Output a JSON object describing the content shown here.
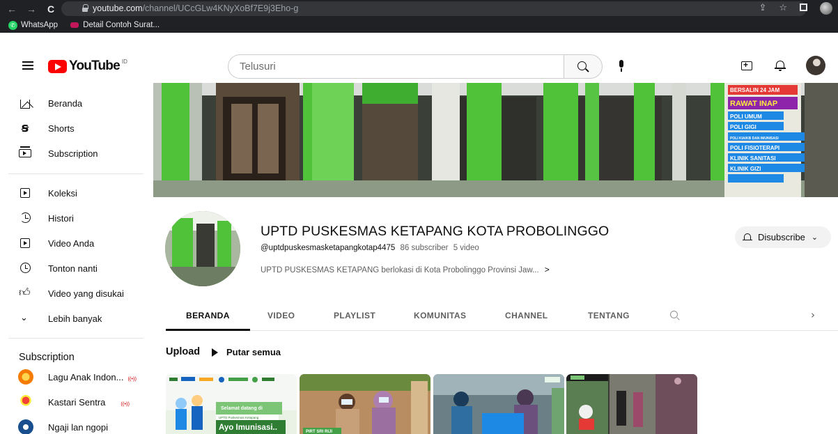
{
  "browser": {
    "url_host": "youtube.com",
    "url_path": "/channel/UCcGLw4KNyXoBf7E9j3Eho-g",
    "bookmarks": [
      {
        "label": "WhatsApp",
        "icon": "whatsapp-icon"
      },
      {
        "label": "Detail Contoh Surat...",
        "icon": "bookmark-favicon"
      }
    ]
  },
  "header": {
    "logo_text": "YouTube",
    "logo_region": "ID",
    "search_placeholder": "Telusuri"
  },
  "sidebar": {
    "items": [
      {
        "label": "Beranda",
        "icon": "home-icon"
      },
      {
        "label": "Shorts",
        "icon": "shorts-icon"
      },
      {
        "label": "Subscription",
        "icon": "subscriptions-icon"
      },
      {
        "label": "Koleksi",
        "icon": "library-icon"
      },
      {
        "label": "Histori",
        "icon": "history-icon"
      },
      {
        "label": "Video Anda",
        "icon": "your-videos-icon"
      },
      {
        "label": "Tonton nanti",
        "icon": "watch-later-icon"
      },
      {
        "label": "Video yang disukai",
        "icon": "liked-videos-icon"
      },
      {
        "label": "Lebih banyak",
        "icon": "chevron-down-icon"
      }
    ],
    "subscription_title": "Subscription",
    "subscriptions": [
      {
        "label": "Lagu Anak Indon...",
        "live": "((•))"
      },
      {
        "label": "Kastari Sentra",
        "live": "((•))"
      },
      {
        "label": "Ngaji lan ngopi",
        "live": ""
      }
    ]
  },
  "channel": {
    "name": "UPTD PUSKESMAS KETAPANG KOTA PROBOLINGGO",
    "handle": "@uptdpuskesmasketapangkotap4475",
    "subscribers": "86 subscriber",
    "videos": "5 video",
    "description": "UPTD PUSKESMAS KETAPANG berlokasi di Kota Probolinggo Provinsi Jaw...",
    "unsubscribe_label": "Disubscribe",
    "banner_signs": [
      "BERSALIN 24 JAM",
      "RAWAT INAP",
      "POLI UMUM",
      "POLI GIGI",
      "POLI KIA/KB DAN IMUNISASI",
      "POLI FISIOTERAPI",
      "KLINIK SANITASI",
      "KLINIK GIZI"
    ]
  },
  "tabs": [
    "BERANDA",
    "VIDEO",
    "PLAYLIST",
    "KOMUNITAS",
    "CHANNEL",
    "TENTANG"
  ],
  "uploads": {
    "title": "Upload",
    "play_all": "Putar semua",
    "thumbnails": [
      {
        "text1": "Selamat datang di",
        "text2": "UPTD Puskesmas Ketapang",
        "text3": "Ayo Imunisasi.."
      },
      {
        "text1": "PIRT SRI RIJI"
      },
      {
        "text1": ""
      },
      {
        "text1": ""
      }
    ]
  },
  "colors": {
    "brand_red": "#ff0000",
    "chrome_dark": "#202124",
    "banner_green": "#4cc23a"
  }
}
